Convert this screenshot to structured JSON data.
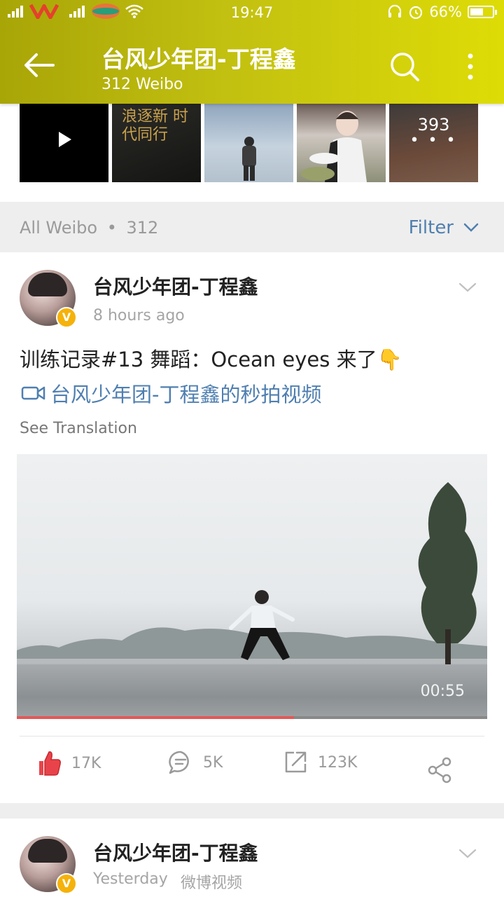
{
  "status_bar": {
    "time": "19:47",
    "battery": "66%",
    "battery_level": 0.66,
    "carrier_logo": "VIETTEL"
  },
  "header": {
    "title": "台风少年团-丁程鑫",
    "subtitle": "312 Weibo",
    "background_gradient": [
      "#a8a507",
      "#dedc06"
    ]
  },
  "thumbnails": [
    {
      "kind": "video",
      "icon": "play-icon"
    },
    {
      "kind": "image",
      "poster_text": "浪逐新 时代同行"
    },
    {
      "kind": "image"
    },
    {
      "kind": "image"
    },
    {
      "kind": "image",
      "overlay_count": "393",
      "overlay_dots": "• • •"
    }
  ],
  "feed_header": {
    "label": "All Weibo",
    "separator": "•",
    "count": "312",
    "filter_label": "Filter"
  },
  "posts": [
    {
      "username": "台风少年团-丁程鑫",
      "time": "8 hours ago",
      "text": "训练记录#13 舞蹈：Ocean eyes 来了👇",
      "video_link": "台风少年团-丁程鑫的秒拍视频",
      "see_translation": "See Translation",
      "video": {
        "duration": "00:55",
        "progress": 0.59
      },
      "actions": {
        "likes": "17K",
        "comments": "5K",
        "reposts": "123K"
      }
    },
    {
      "username": "台风少年团-丁程鑫",
      "time": "Yesterday",
      "source": "微博视频"
    }
  ],
  "colors": {
    "link_blue": "#4f7fb0",
    "like_red": "#e8434a",
    "verified_gold": "#f5b20a"
  }
}
